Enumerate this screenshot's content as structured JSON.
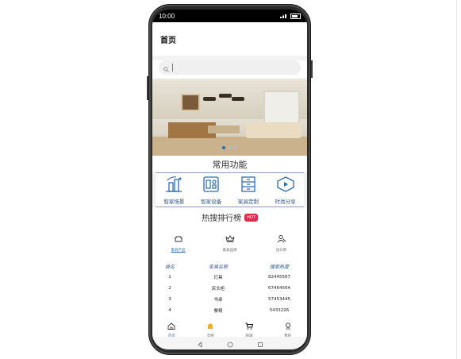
{
  "status": {
    "time": "10:00"
  },
  "header": {
    "title": "首页"
  },
  "search": {
    "placeholder": ""
  },
  "functions": {
    "title": "常用功能",
    "items": [
      {
        "label": "智家场景",
        "icon": "smart-scene-icon"
      },
      {
        "label": "智家设备",
        "icon": "smart-device-icon"
      },
      {
        "label": "家具定制",
        "icon": "furniture-custom-icon"
      },
      {
        "label": "时尚分享",
        "icon": "share-icon"
      }
    ]
  },
  "hot": {
    "title": "热搜排行榜",
    "badge": "HOT",
    "tabs": [
      {
        "label": "家具产品",
        "icon": "sofa-icon",
        "active": true
      },
      {
        "label": "家具品牌",
        "icon": "crown-icon",
        "active": false
      },
      {
        "label": "设计师",
        "icon": "designer-icon",
        "active": false
      }
    ],
    "table": {
      "headers": [
        "排名",
        "家具名称",
        "搜索热度"
      ],
      "rows": [
        [
          "1",
          "灯具",
          "82445567"
        ],
        [
          "2",
          "床头柜",
          "67464564"
        ],
        [
          "3",
          "书桌",
          "57453445"
        ],
        [
          "4",
          "餐椅",
          "5433226"
        ]
      ]
    }
  },
  "tabbar": {
    "items": [
      {
        "label": "首页",
        "icon": "home-icon",
        "active": true
      },
      {
        "label": "灵感",
        "icon": "inspiration-icon",
        "active": false
      },
      {
        "label": "商城",
        "icon": "cart-icon",
        "active": false
      },
      {
        "label": "我的",
        "icon": "profile-icon",
        "active": false
      }
    ]
  },
  "colors": {
    "accent": "#2b6cb0",
    "hot_badge": "#e0294b",
    "label": "#2b4f8f"
  }
}
